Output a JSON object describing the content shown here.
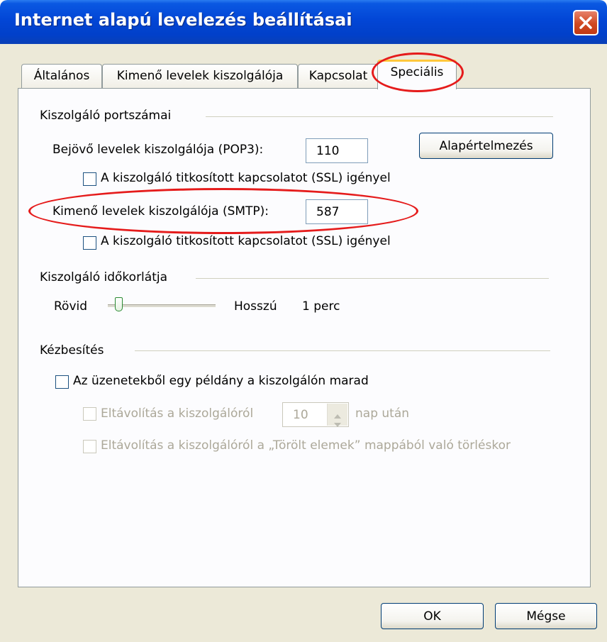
{
  "window": {
    "title": "Internet alapú levelezés beállításai"
  },
  "tabs": [
    "Általános",
    "Kimenő levelek kiszolgálója",
    "Kapcsolat",
    "Speciális"
  ],
  "ports_section": {
    "heading": "Kiszolgáló portszámai",
    "incoming_label": "Bejövő levelek kiszolgálója (POP3):",
    "incoming_value": "110",
    "incoming_ssl_label": "A kiszolgáló titkosított kapcsolatot (SSL) igényel",
    "outgoing_label": "Kimenő levelek kiszolgálója (SMTP):",
    "outgoing_value": "587",
    "outgoing_ssl_label": "A kiszolgáló titkosított kapcsolatot (SSL) igényel",
    "defaults_button": "Alapértelmezés"
  },
  "timeout_section": {
    "heading": "Kiszolgáló időkorlátja",
    "short_label": "Rövid",
    "long_label": "Hosszú",
    "value_text": "1 perc",
    "slider_level": 0.0
  },
  "delivery_section": {
    "heading": "Kézbesítés",
    "leave_copy_label": "Az üzenetekből egy példány a kiszolgálón marad",
    "remove_after_label": "Eltávolítás a kiszolgálóról",
    "days_value": "10",
    "days_suffix": "nap után",
    "remove_on_delete_label": "Eltávolítás a kiszolgálóról a „Törölt elemek” mappából való törléskor"
  },
  "footer": {
    "ok_label": "OK",
    "cancel_label": "Mégse"
  },
  "colors": {
    "title_bar": "#0246d6",
    "annotation": "#e51b1b",
    "dialog_bg": "#ece9d8"
  }
}
